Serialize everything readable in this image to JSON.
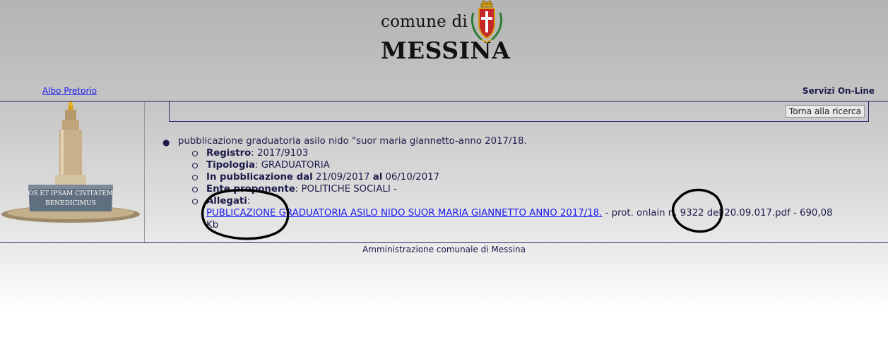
{
  "header": {
    "logo_small": "comune di",
    "logo_big": "MESSINA"
  },
  "topbar": {
    "albo_link": "Albo Pretorio",
    "servizi": "Servizi On-Line"
  },
  "search": {
    "torna_button": "Torna alla ricerca"
  },
  "monument": {
    "inscription_line1": "OS ET IPSAM CIVITATEM",
    "inscription_line2": "BENEDICIMUS"
  },
  "record": {
    "title": "pubblicazione graduatoria asilo nido \"suor maria giannetto-anno 2017/18.",
    "registro_label": "Registro",
    "registro_value": ": 2017/9103",
    "tipologia_label": "Tipologia",
    "tipologia_value": ": GRADUATORIA",
    "pubblicazione_label": "In pubblicazione dal",
    "pubblicazione_from": " 21/09/2017 ",
    "pubblicazione_al": "al",
    "pubblicazione_to": " 06/10/2017",
    "ente_label": "Ente proponente",
    "ente_value": ": POLITICHE SOCIALI -",
    "allegati_label": "Allegati",
    "allegati_colon": ":",
    "attachment_link": "PUBLICAZIONE GRADUATORIA ASILO NIDO SUOR MARIA GIANNETTO ANNO 2017/18.",
    "attachment_rest": " - prot. onlain n. 9322 del 20.09.017.pdf - 690,08",
    "attachment_kb": "Kb"
  },
  "footer": {
    "text": "Amministrazione comunale di Messina"
  },
  "colors": {
    "link": "#1a1aee",
    "text": "#1b1b4b",
    "rule": "#23236b",
    "annotation": "#000000"
  }
}
